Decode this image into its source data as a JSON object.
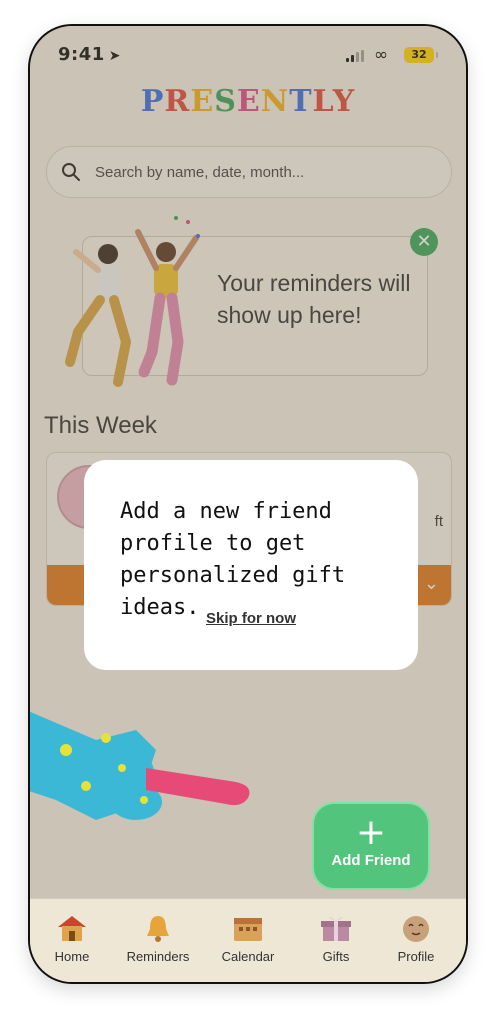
{
  "status_bar": {
    "time": "9:41",
    "battery": "32"
  },
  "app": {
    "logo_letters": [
      "P",
      "R",
      "E",
      "S",
      "E",
      "N",
      "T",
      "LY"
    ]
  },
  "search": {
    "placeholder": "Search by name, date, month..."
  },
  "reminders_card": {
    "message": "Your reminders will show up here!"
  },
  "this_week": {
    "title": "This Week",
    "partial_text": "ft"
  },
  "modal": {
    "message": "Add a new friend profile to get personalized gift ideas.",
    "skip_label": "Skip for now"
  },
  "fab": {
    "plus": "+",
    "label": "Add Friend"
  },
  "nav": {
    "items": [
      {
        "label": "Home",
        "icon": "house-icon"
      },
      {
        "label": "Reminders",
        "icon": "bell-icon"
      },
      {
        "label": "Calendar",
        "icon": "calendar-icon"
      },
      {
        "label": "Gifts",
        "icon": "gift-icon"
      },
      {
        "label": "Profile",
        "icon": "face-icon"
      }
    ]
  },
  "colors": {
    "accent_green": "#53c47c",
    "close_green": "#3aa85c",
    "orange_bar": "#e07a1f"
  }
}
